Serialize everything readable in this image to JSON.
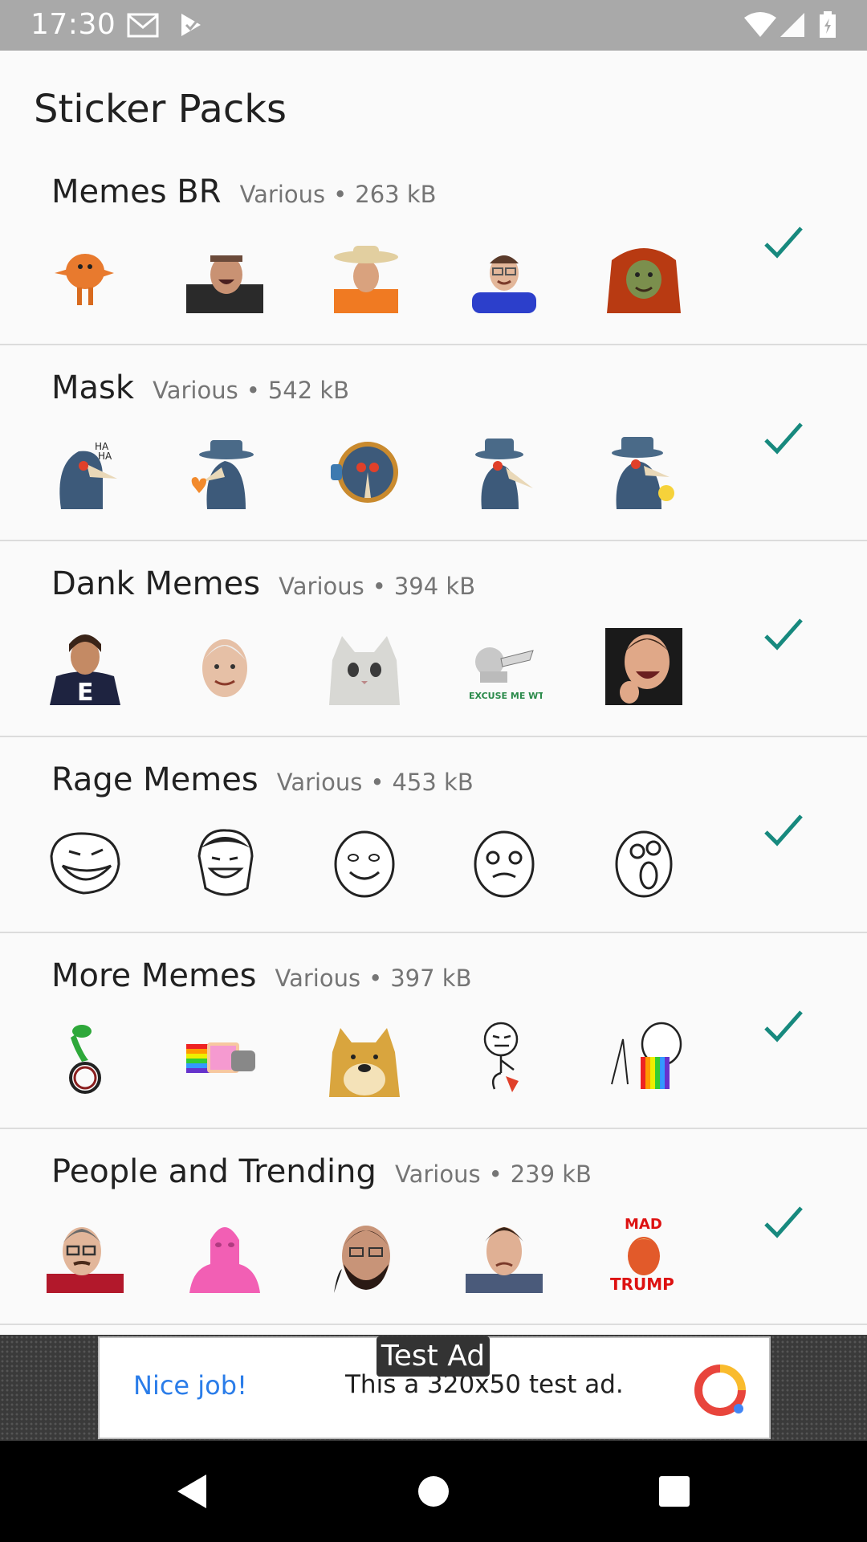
{
  "status_bar": {
    "time": "17:30",
    "left_icons": [
      "gmail-icon",
      "play-store-icon"
    ],
    "right_icons": [
      "wifi-icon",
      "cell-signal-icon",
      "battery-icon"
    ]
  },
  "page_title": "Sticker Packs",
  "packs": [
    {
      "name": "Memes BR",
      "publisher": "Various",
      "size": "263 kB",
      "added": true,
      "stickers": [
        "orange-creature-sticker",
        "laughing-man-sticker",
        "cowboy-hat-man-sticker",
        "smiling-boy-sticker",
        "hooded-zombie-sticker"
      ]
    },
    {
      "name": "Mask",
      "publisher": "Various",
      "size": "542 kB",
      "added": true,
      "stickers": [
        "plague-doctor-laughing-sticker",
        "plague-doctor-heart-sticker",
        "plague-doctor-thumbs-up-sticker",
        "plague-doctor-standing-sticker",
        "plague-doctor-lantern-sticker"
      ]
    },
    {
      "name": "Dank Memes",
      "publisher": "Various",
      "size": "394 kB",
      "added": true,
      "stickers": [
        "lord-farquaad-e-sticker",
        "hide-the-pain-harold-sticker",
        "crying-cat-sticker",
        "excuse-me-wtf-sticker",
        "laughing-streamer-sticker"
      ]
    },
    {
      "name": "Rage Memes",
      "publisher": "Various",
      "size": "453 kB",
      "added": true,
      "stickers": [
        "trollface-sticker",
        "yao-ming-sticker",
        "forever-alone-sticker",
        "me-gusta-sticker",
        "omg-face-sticker"
      ]
    },
    {
      "name": "More Memes",
      "publisher": "Various",
      "size": "397 kB",
      "added": true,
      "stickers": [
        "dat-boi-frog-sticker",
        "nyan-cat-sticker",
        "doge-sticker",
        "rocket-meme-sticker",
        "rainbow-puke-sticker"
      ]
    },
    {
      "name": "People and Trending",
      "publisher": "Various",
      "size": "239 kB",
      "added": true,
      "stickers": [
        "man-with-glasses-sticker",
        "pink-guy-sticker",
        "neckbeard-sticker",
        "crying-man-sticker",
        "mad-trump-sticker"
      ]
    }
  ],
  "mad_trump": {
    "top": "MAD",
    "bottom": "TRUMP"
  },
  "excuse_text": "EXCUSE ME WTF",
  "ad": {
    "label": "Test Ad",
    "headline": "Nice job!",
    "body": "This a 320x50 test ad."
  },
  "nav": {
    "icons": [
      "back-icon",
      "home-icon",
      "recents-icon"
    ]
  },
  "colors": {
    "accent": "#17897e",
    "ad_link": "#2b7de9",
    "status_bar": "#a9a9a9"
  }
}
